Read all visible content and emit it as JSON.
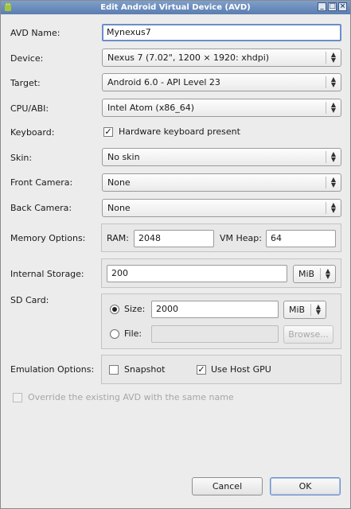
{
  "window": {
    "title": "Edit Android Virtual Device (AVD)",
    "buttons": {
      "minimize": "_",
      "maximize": "□",
      "close": "×"
    }
  },
  "avd_name": {
    "label": "AVD Name:",
    "value": "Mynexus7"
  },
  "device": {
    "label": "Device:",
    "value": "Nexus 7 (7.02\", 1200 × 1920: xhdpi)"
  },
  "target": {
    "label": "Target:",
    "value": "Android 6.0 - API Level 23"
  },
  "cpu": {
    "label": "CPU/ABI:",
    "value": "Intel Atom (x86_64)"
  },
  "keyboard": {
    "label": "Keyboard:",
    "option": "Hardware keyboard present",
    "checked": true
  },
  "skin": {
    "label": "Skin:",
    "value": "No skin"
  },
  "front_camera": {
    "label": "Front Camera:",
    "value": "None"
  },
  "back_camera": {
    "label": "Back Camera:",
    "value": "None"
  },
  "memory": {
    "label": "Memory Options:",
    "ram_label": "RAM:",
    "ram_value": "2048",
    "vm_heap_label": "VM Heap:",
    "vm_heap_value": "64"
  },
  "internal_storage": {
    "label": "Internal Storage:",
    "value": "200",
    "unit": "MiB"
  },
  "sd_card": {
    "label": "SD Card:",
    "size_label": "Size:",
    "size_value": "2000",
    "size_unit": "MiB",
    "size_selected": true,
    "file_label": "File:",
    "file_value": "",
    "browse_label": "Browse..."
  },
  "emulation": {
    "label": "Emulation Options:",
    "snapshot_label": "Snapshot",
    "snapshot_checked": false,
    "gpu_label": "Use Host GPU",
    "gpu_checked": true
  },
  "override": {
    "label": "Override the existing AVD with the same name",
    "checked": false,
    "enabled": false
  },
  "actions": {
    "cancel": "Cancel",
    "ok": "OK"
  },
  "glyphs": {
    "check": "✓",
    "arrows": "▲▼"
  }
}
